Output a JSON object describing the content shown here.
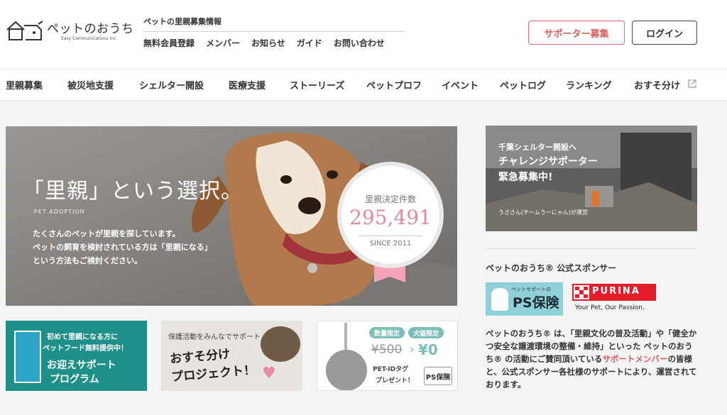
{
  "header": {
    "logo_title": "ペットのおうち",
    "logo_sub": "Easy Communications Inc.",
    "top_label": "ペットの里親募集情報",
    "top_links": [
      "無料会員登録",
      "メンバー",
      "お知らせ",
      "ガイド",
      "お問い合わせ"
    ],
    "supporter_button": "サポーター募集",
    "login_button": "ログイン"
  },
  "nav": {
    "items": [
      "里親募集",
      "被災地支援",
      "シェルター開設",
      "医療支援",
      "ストーリーズ",
      "ペットプロフ",
      "イベント",
      "ペットログ",
      "ランキング",
      "おすそ分け"
    ]
  },
  "hero": {
    "title": "「里親」という選択。",
    "subtitle": "PET ADOPTION",
    "desc": [
      "たくさんのペットが里親を探しています。",
      "ペットの飼育を検討されている方は「里親になる」",
      "という方法もご検討ください。"
    ],
    "badge_label": "里親決定件数",
    "badge_count": "295,491",
    "badge_since": "SINCE 2011"
  },
  "banners": {
    "food": {
      "line1": "初めて里親になる方に",
      "line2": "ペットフード無料提供中！",
      "line3": "お迎えサポート",
      "line4": "プログラム"
    },
    "share": {
      "line1": "保護活動をみんなでサポート",
      "line2": "おすそ分け",
      "line3": "プロジェクト！"
    },
    "petid": {
      "pill1": "数量限定",
      "pill2": "犬猫限定",
      "old_price": "¥500",
      "arrow": "›",
      "new_price": "¥0",
      "line1": "PET-IDタグ",
      "line2": "プレゼント！",
      "ps": "PS保険"
    }
  },
  "side_banner": {
    "line1": "千葉シェルター開設へ",
    "line2": "チャレンジサポーター",
    "line3": "緊急募集中!",
    "line4": "うささん(チームうーにゃん)が運営"
  },
  "sponsors": {
    "heading": "ペットのおうち® 公式スポンサー",
    "ps_small": "ペットサポートの",
    "ps_main": "PS保険",
    "purina_word": "PURINA",
    "purina_tag": "Your Pet, Our Passion.",
    "text_before": "ペットのおうち® は、「里親文化の普及活動」や「健全かつ安全な譲渡環境の整備・維持」といった ペットのおうち® の活動にご賛同頂いている",
    "text_link": "サポートメンバー",
    "text_after": "の皆様と、公式スポンサー各社様のサポートにより、運営されております。"
  },
  "colors": {
    "accent_red": "#e25b5b",
    "badge_pink": "#e38a9e",
    "teal": "#1f8f8a",
    "ps_blue": "#8fd1d6",
    "purina_red": "#e31d2b"
  }
}
